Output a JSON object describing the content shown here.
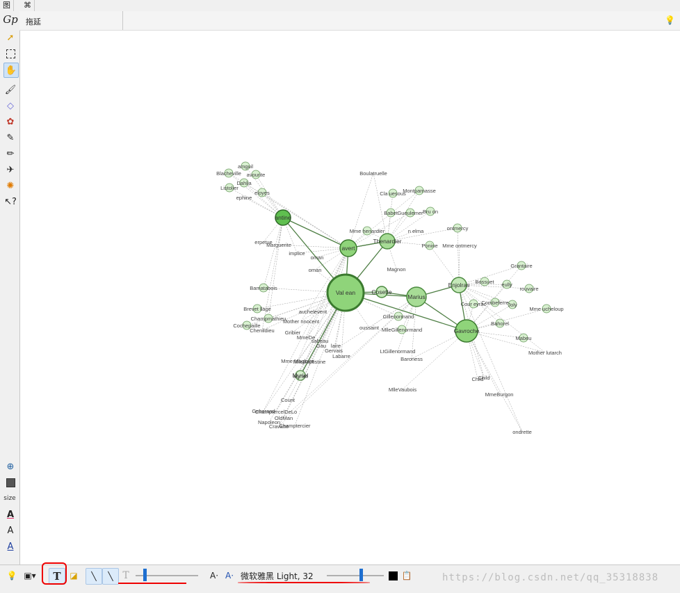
{
  "top_tabs": [
    {
      "label": "图"
    },
    {
      "label": "⌘"
    }
  ],
  "sidebar": {
    "logo": "Gp",
    "tools": [
      {
        "icon": "arrow-pointer-icon"
      },
      {
        "icon": "rect-select-icon"
      },
      {
        "icon": "lasso-select-icon"
      },
      {
        "icon": "brush-icon"
      },
      {
        "icon": "diamond-icon"
      },
      {
        "icon": "palette-icon"
      },
      {
        "icon": "pencil-icon"
      },
      {
        "icon": "pencil2-icon"
      },
      {
        "icon": "airplane-icon"
      },
      {
        "icon": "gear-icon"
      },
      {
        "icon": "help-cursor-icon"
      }
    ],
    "size_label": "size"
  },
  "infobar": {
    "label": "拖延"
  },
  "graph": {
    "nodes": [
      {
        "name": "Val ean",
        "r": 26,
        "color": "#8fd47a",
        "stroke": "#3b7a2f"
      },
      {
        "name": "avert",
        "r": 12,
        "color": "#8fd47a",
        "stroke": "#3b7a2f"
      },
      {
        "name": "antine",
        "r": 11,
        "color": "#5fbf4f",
        "stroke": "#2f6a27"
      },
      {
        "name": "Marius",
        "r": 14,
        "color": "#a7dc96",
        "stroke": "#4b8a3f"
      },
      {
        "name": "Gavroche",
        "r": 16,
        "color": "#8fd47a",
        "stroke": "#3b7a2f"
      },
      {
        "name": "Thenardier",
        "r": 11,
        "color": "#a7dc96",
        "stroke": "#4b8a3f"
      },
      {
        "name": "Enjolras",
        "r": 11,
        "color": "#c4e8b8",
        "stroke": "#4b8a3f"
      },
      {
        "name": "Cosette",
        "r": 8,
        "color": "#c4e8b8",
        "stroke": "#4b8a3f"
      },
      {
        "name": "Myriel",
        "r": 7,
        "color": "#d8f0d0",
        "stroke": "#6a9a5f"
      }
    ],
    "labels": [
      "Boulatruelle",
      "Cla uesous",
      "Montparnasse",
      "Babet",
      "Gueulemer",
      "Bru on",
      "Mme henardier",
      "n elma",
      "ontmercy",
      "Mme ontmercy",
      "Ponine",
      "Magnon",
      "Marguerite",
      "erpetue",
      "implice",
      "oman",
      "oman",
      "amguil",
      "Blacheville",
      "avourite",
      "Dahlia",
      "Listolier",
      "eloyes",
      "ephine",
      "Bamatabois",
      "Brevet llage",
      "Champmathieu",
      "Cochepaille",
      "Chenildieu",
      "auchelevent",
      "Mother nnocent",
      "Gribier",
      "MmeDe",
      "sabeau",
      "Gau",
      "laire",
      "Gervais",
      "Labarre",
      "Mme Magloire",
      "MlleBaptistine",
      "Myriel",
      "Count",
      "Geborand",
      "ChamptercelDeLo",
      "OldMan",
      "Napoleon",
      "Cravatte",
      "Champtercier",
      "Gillenormand",
      "MlleGillenormand",
      "oussaint",
      "LtGillenormand",
      "Baroness",
      "MlleVaubois",
      "Grantaire",
      "Bossuet",
      "eully",
      "rouvaire",
      "Cour eyrac",
      "Combeferre",
      "Joly",
      "Mme ucheloup",
      "Bahorel",
      "Mabeu",
      "Mother lutarch",
      "Child",
      "Child",
      "MmeBurgon",
      "ondrette"
    ]
  },
  "bottombar": {
    "font_name": "微软雅黑 Light, 32",
    "watermark": "https://blog.csdn.net/qq_35318838"
  }
}
